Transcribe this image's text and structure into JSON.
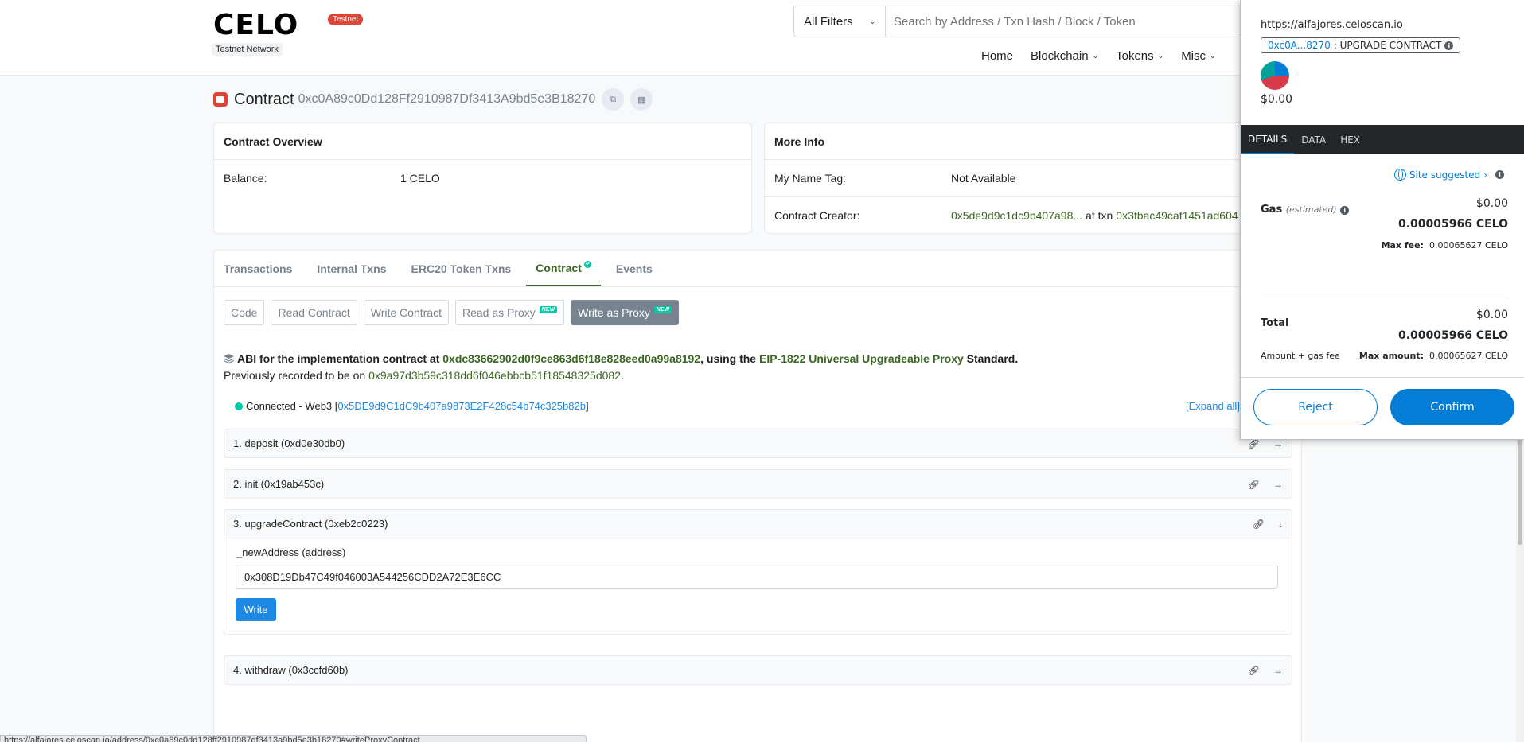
{
  "header": {
    "logo_text": "CELO",
    "badge": "Testnet",
    "network": "Testnet Network",
    "filter": "All Filters",
    "search_placeholder": "Search by Address / Txn Hash / Block / Token",
    "nav": [
      "Home",
      "Blockchain",
      "Tokens",
      "Misc"
    ]
  },
  "contract": {
    "label": "Contract",
    "address": "0xc0A89c0Dd128Ff2910987Df3413A9bd5e3B18270"
  },
  "overview": {
    "title": "Contract Overview",
    "balance_label": "Balance:",
    "balance_value": "1 CELO"
  },
  "more_info": {
    "title": "More Info",
    "name_tag_label": "My Name Tag:",
    "name_tag_value": "Not Available",
    "creator_label": "Contract Creator:",
    "creator_address": "0x5de9d9c1dc9b407a98...",
    "at_txn": "at txn",
    "creator_txn": "0x3fbac49caf1451ad604"
  },
  "tabs": [
    "Transactions",
    "Internal Txns",
    "ERC20 Token Txns",
    "Contract",
    "Events"
  ],
  "sub_buttons": {
    "code": "Code",
    "read_contract": "Read Contract",
    "write_contract": "Write Contract",
    "read_proxy": "Read as Proxy",
    "write_proxy": "Write as Proxy",
    "new": "NEW"
  },
  "abi": {
    "prefix": "ABI for the implementation contract at",
    "impl_address": "0xdc83662902d0f9ce863d6f18e828eed0a99a8192",
    "using_the": ", using the",
    "eip_link": "EIP-1822 Universal Upgradeable Proxy",
    "standard": "Standard.",
    "previously": "Previously recorded to be on",
    "previous_address": "0x9a97d3b59c318dd6f046ebbcb51f18548325d082",
    "period": "."
  },
  "connection": {
    "text": "Connected - Web3 [",
    "address": "0x5DE9d9C1dC9b407a9873E2F428c54b74c325b82b",
    "close": "]",
    "expand_all": "[Expand all]"
  },
  "functions": [
    {
      "label": "1. deposit (0xd0e30db0)"
    },
    {
      "label": "2. init (0x19ab453c)"
    },
    {
      "label": "3. upgradeContract (0xeb2c0223)",
      "param_label": "_newAddress (address)",
      "param_value": "0x308D19Db47C49f046003A544256CDD2A72E3E6CC",
      "write": "Write"
    },
    {
      "label": "4. withdraw (0x3ccfd60b)"
    }
  ],
  "status_url": "https://alfajores.celoscan.io/address/0xc0a89c0dd128ff2910987df3413a9bd5e3b18270#writeProxyContract",
  "metamask": {
    "url": "https://alfajores.celoscan.io",
    "chip_address": "0xc0A...8270",
    "chip_action": ": UPGRADE CONTRACT",
    "balance": "$0.00",
    "tabs": [
      "DETAILS",
      "DATA",
      "HEX"
    ],
    "site_suggested": "Site suggested",
    "gas_label": "Gas",
    "gas_estimated": "(estimated)",
    "gas_usd": "$0.00",
    "gas_celo": "0.00005966 CELO",
    "max_fee_label": "Max fee:",
    "max_fee_value": "0.00065627 CELO",
    "total_label": "Total",
    "total_usd": "$0.00",
    "total_celo": "0.00005966 CELO",
    "amount_gas_fee": "Amount + gas fee",
    "max_amount_label": "Max amount:",
    "max_amount_value": "0.00065627 CELO",
    "reject": "Reject",
    "confirm": "Confirm"
  },
  "colors": {
    "green_link": "#3b6623",
    "blue_link": "#1e88e5",
    "metamask_blue": "#037dd6",
    "badge_red": "#de4437"
  }
}
